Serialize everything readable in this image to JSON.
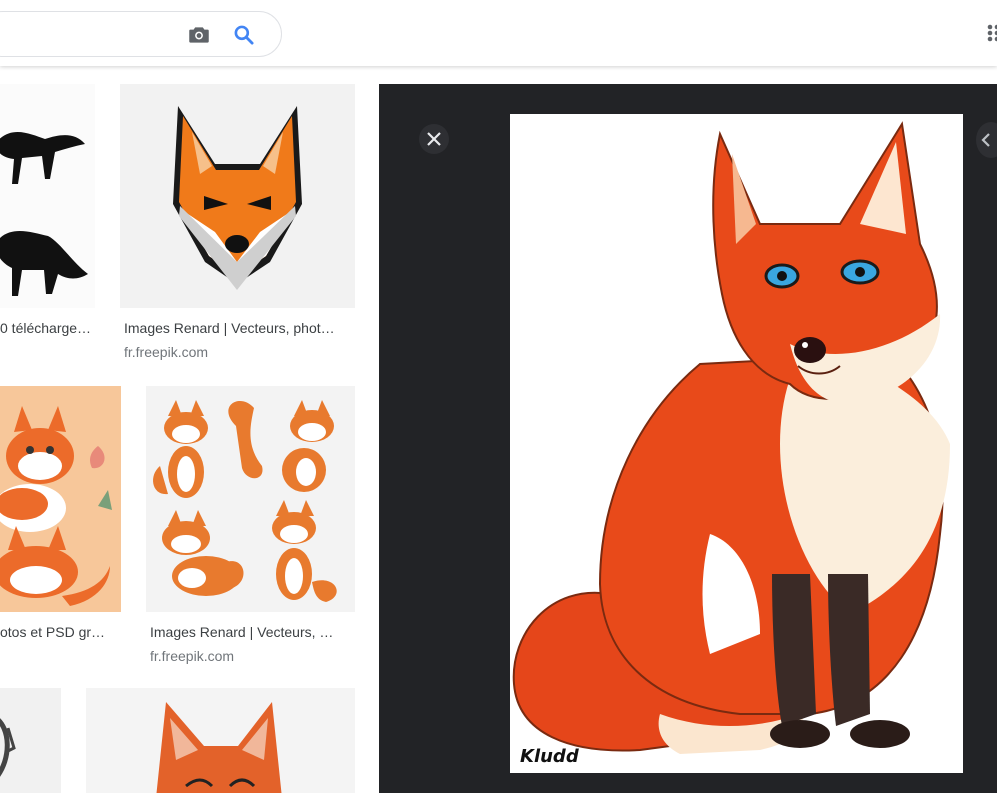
{
  "search": {
    "value": "",
    "placeholder": "",
    "camera_icon": "camera-icon",
    "search_icon": "search-icon"
  },
  "apps_icon": "apps-grid-icon",
  "results": [
    {
      "caption": "0 télécharge…",
      "source": ""
    },
    {
      "caption": "Images Renard | Vecteurs, phot…",
      "source": "fr.freepik.com"
    },
    {
      "caption": "otos et PSD gr…",
      "source": ""
    },
    {
      "caption": "Images Renard | Vecteurs, …",
      "source": "fr.freepik.com"
    }
  ],
  "preview": {
    "close_icon": "close-icon",
    "prev_icon": "chevron-left-icon",
    "signature": "Kludd"
  },
  "colors": {
    "fox_orange": "#e8501c",
    "preview_bg": "#222326",
    "link_gray": "#70757a",
    "accent_blue": "#4285f4"
  }
}
